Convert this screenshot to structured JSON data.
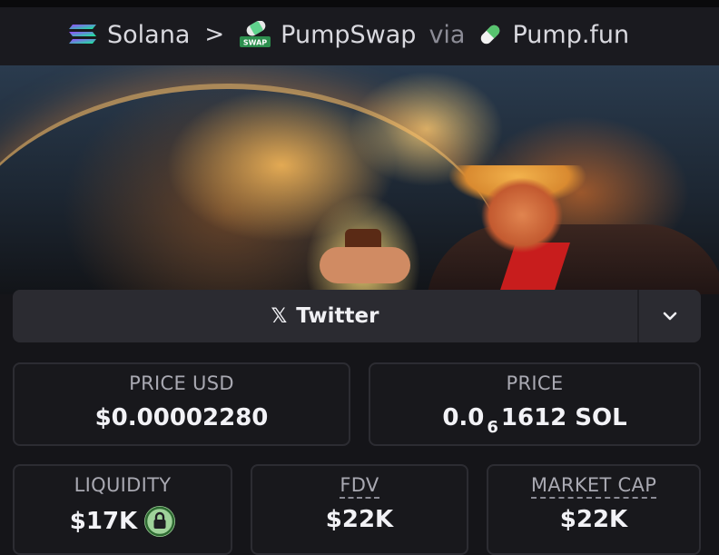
{
  "breadcrumb": {
    "chain": "Solana",
    "separator": ">",
    "dex": "PumpSwap",
    "dex_badge": "SWAP",
    "via": "via",
    "launchpad": "Pump.fun"
  },
  "icons": {
    "chain": "solana-icon",
    "dex": "pumpswap-icon",
    "launchpad": "pumpfun-pill-icon",
    "x": "x-icon",
    "chevron": "chevron-down-icon",
    "lock": "lock-icon"
  },
  "social": {
    "x_glyph": "𝕏",
    "label": "Twitter"
  },
  "stats": {
    "price_usd": {
      "label": "PRICE USD",
      "value": "$0.00002280"
    },
    "price": {
      "label": "PRICE",
      "prefix": "0.0",
      "zeros": "6",
      "digits": "1612",
      "unit": "SOL"
    },
    "liquidity": {
      "label": "LIQUIDITY",
      "value": "$17K"
    },
    "fdv": {
      "label": "FDV",
      "value": "$22K"
    },
    "market_cap": {
      "label": "MARKET CAP",
      "value": "$22K"
    }
  },
  "colors": {
    "background": "#151519",
    "card_border": "#2c2c32",
    "lock_green": "#9fd29a"
  }
}
